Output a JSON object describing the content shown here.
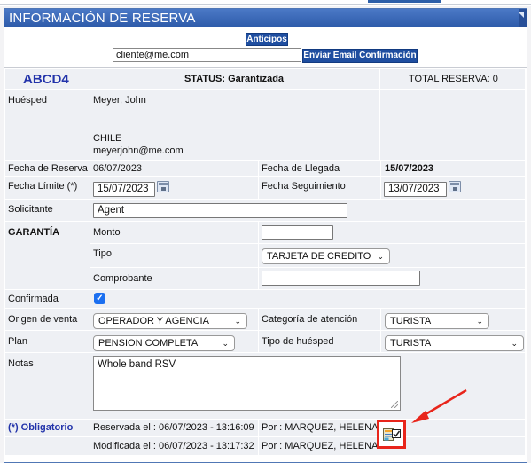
{
  "header": {
    "title": "INFORMACIÓN DE RESERVA"
  },
  "toolbar": {
    "anticipos_label": "Anticipos",
    "email_value": "cliente@me.com",
    "send_email_label": "Enviar Email Confirmación"
  },
  "summary": {
    "code": "ABCD4",
    "status": "STATUS: Garantizada",
    "total": "TOTAL RESERVA: 0"
  },
  "guest": {
    "label": "Huésped",
    "name": "Meyer, John",
    "country": "CHILE",
    "email": "meyerjohn@me.com"
  },
  "dates": {
    "booking_label": "Fecha de Reserva",
    "booking_value": "06/07/2023",
    "arrival_label": "Fecha de Llegada",
    "arrival_value": "15/07/2023",
    "limit_label": "Fecha Límite (*)",
    "limit_value": "15/07/2023",
    "followup_label": "Fecha Seguimiento",
    "followup_value": "13/07/2023"
  },
  "requester": {
    "label": "Solicitante",
    "value": "Agent"
  },
  "guarantee": {
    "label": "GARANTÍA",
    "amount_label": "Monto",
    "amount_value": "",
    "type_label": "Tipo",
    "type_value": "TARJETA DE CREDITO",
    "receipt_label": "Comprobante",
    "receipt_value": ""
  },
  "confirmed": {
    "label": "Confirmada",
    "checked": true
  },
  "sale": {
    "origin_label": "Origen de venta",
    "origin_value": "OPERADOR Y AGENCIA",
    "category_label": "Categoría de atención",
    "category_value": "TURISTA",
    "plan_label": "Plan",
    "plan_value": "PENSION COMPLETA",
    "guest_type_label": "Tipo de huésped",
    "guest_type_value": "TURISTA"
  },
  "notes": {
    "label": "Notas",
    "value": "Whole band RSV"
  },
  "footer": {
    "mandatory": "(*) Obligatorio",
    "reserved": "Reservada el : 06/07/2023 - 13:16:09",
    "reserved_by": "Por : MARQUEZ, HELENA",
    "modified": "Modificada el : 06/07/2023 - 13:17:32",
    "modified_by": "Por : MARQUEZ, HELENA"
  },
  "colors": {
    "header": "#2d5aa9",
    "accent_code": "#2233aa",
    "annotation": "#e8251b",
    "checkbox": "#1b6ff0"
  },
  "icons": [
    "calendar-icon",
    "chevron-down-icon",
    "checkmark-icon",
    "edit-record-icon",
    "annotation-arrow"
  ]
}
